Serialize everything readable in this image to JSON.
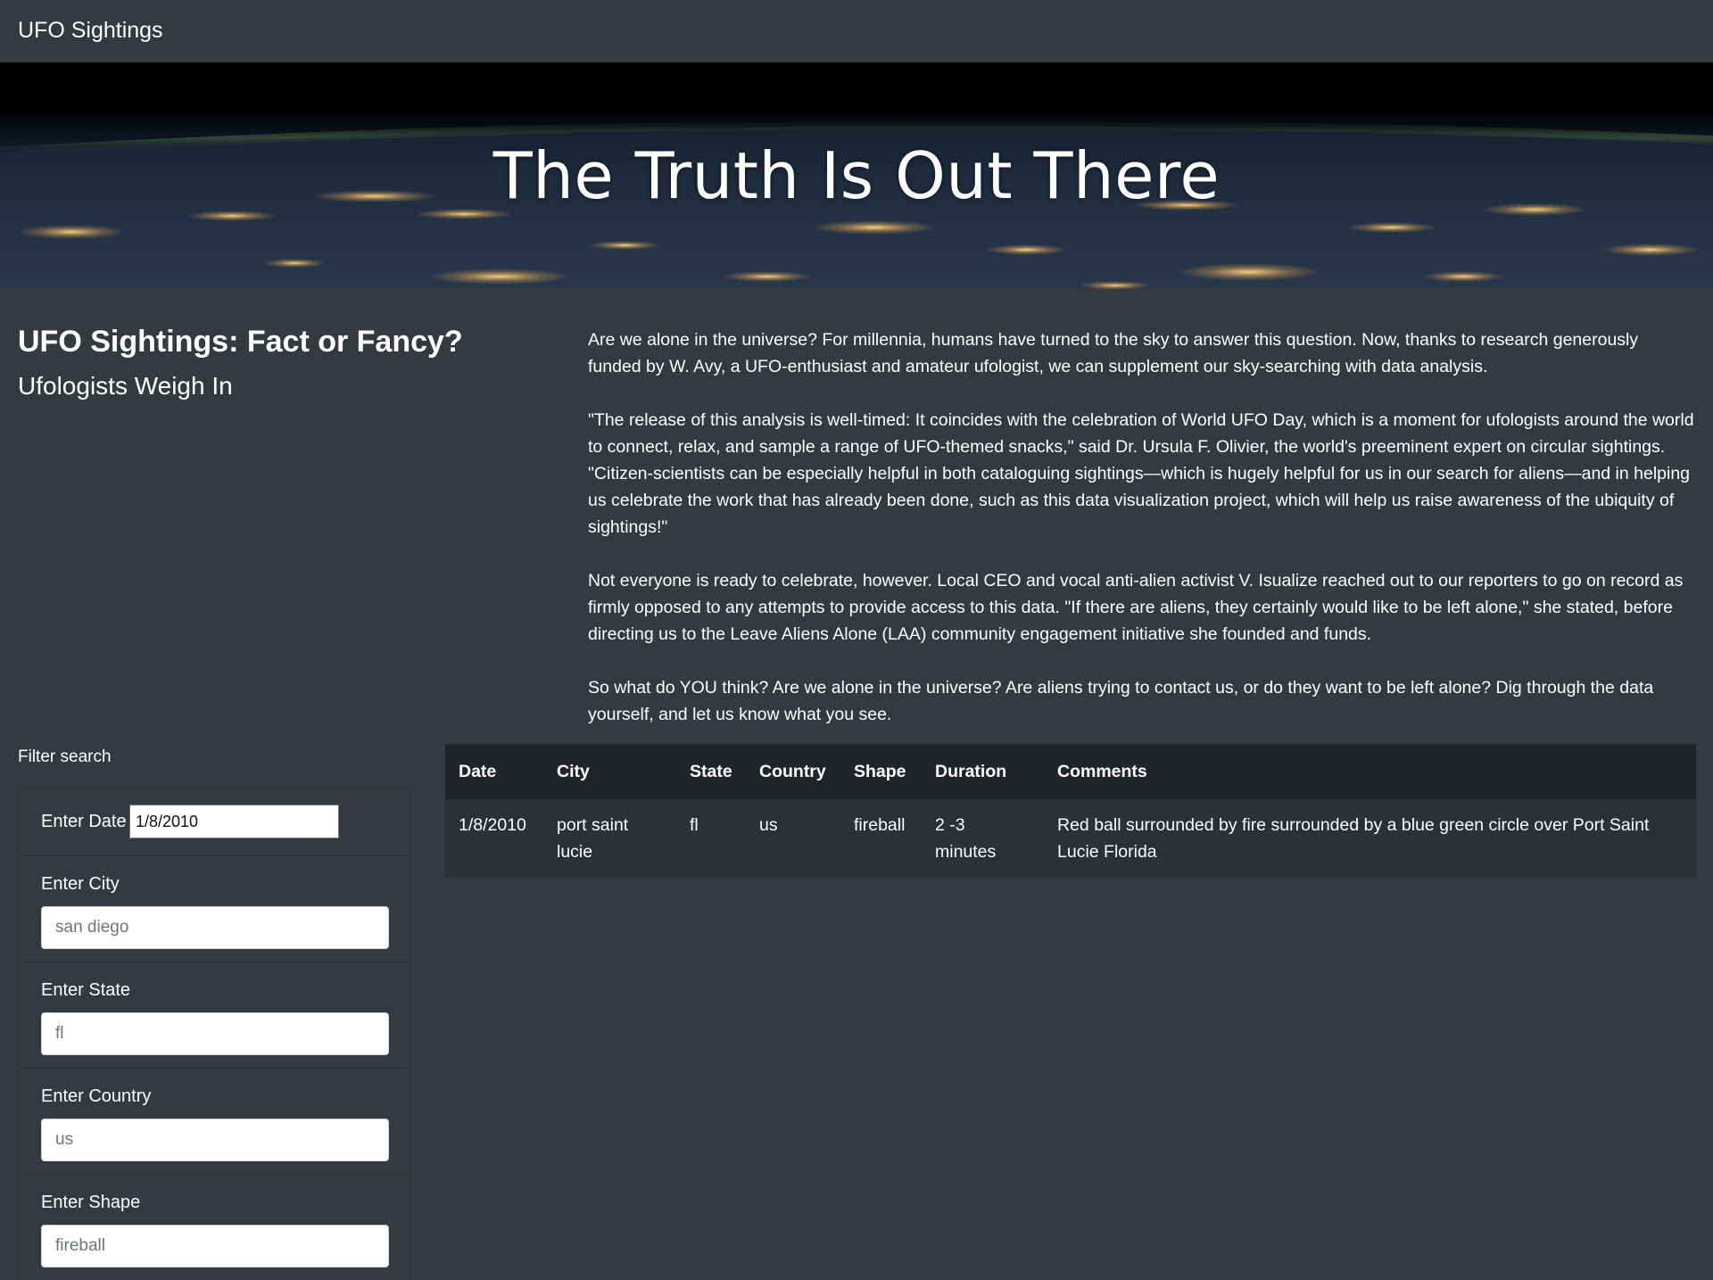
{
  "navbar": {
    "brand": "UFO Sightings"
  },
  "hero": {
    "title": "The Truth Is Out There"
  },
  "heading": {
    "main": "UFO Sightings: Fact or Fancy?",
    "sub": "Ufologists Weigh In"
  },
  "article": {
    "paragraphs": [
      "Are we alone in the universe? For millennia, humans have turned to the sky to answer this question. Now, thanks to research generously funded by W. Avy, a UFO-enthusiast and amateur ufologist, we can supplement our sky-searching with data analysis.",
      "\"The release of this analysis is well-timed: It coincides with the celebration of World UFO Day, which is a moment for ufologists around the world to connect, relax, and sample a range of UFO-themed snacks,\" said Dr. Ursula F. Olivier, the world's preeminent expert on circular sightings. \"Citizen-scientists can be especially helpful in both cataloguing sightings—which is hugely helpful for us in our search for aliens—and in helping us celebrate the work that has already been done, such as this data visualization project, which will help us raise awareness of the ubiquity of sightings!\"",
      "Not everyone is ready to celebrate, however. Local CEO and vocal anti-alien activist V. Isualize reached out to our reporters to go on record as firmly opposed to any attempts to provide access to this data. \"If there are aliens, they certainly would like to be left alone,\" she stated, before directing us to the Leave Aliens Alone (LAA) community engagement initiative she founded and funds.",
      "So what do YOU think? Are we alone in the universe? Are aliens trying to contact us, or do they want to be left alone? Dig through the data yourself, and let us know what you see."
    ]
  },
  "filters": {
    "title": "Filter search",
    "date": {
      "label": "Enter Date",
      "value": "1/8/2010"
    },
    "city": {
      "label": "Enter City",
      "placeholder": "san diego"
    },
    "state": {
      "label": "Enter State",
      "placeholder": "fl"
    },
    "country": {
      "label": "Enter Country",
      "placeholder": "us"
    },
    "shape": {
      "label": "Enter Shape",
      "placeholder": "fireball"
    }
  },
  "table": {
    "headers": [
      "Date",
      "City",
      "State",
      "Country",
      "Shape",
      "Duration",
      "Comments"
    ],
    "rows": [
      {
        "date": "1/8/2010",
        "city": "port saint lucie",
        "state": "fl",
        "country": "us",
        "shape": "fireball",
        "duration": "2 -3 minutes",
        "comments": "Red ball surrounded by fire surrounded by a blue green circle over Port Saint Lucie Florida"
      }
    ]
  }
}
